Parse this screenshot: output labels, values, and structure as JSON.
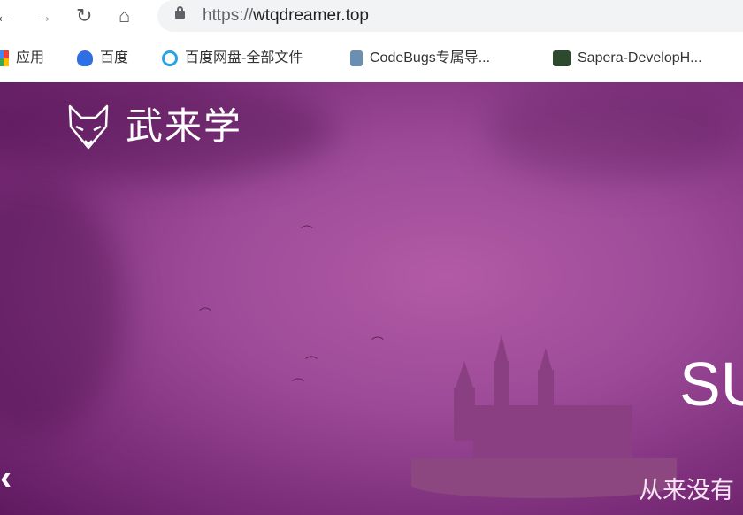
{
  "browser": {
    "url_scheme": "https://",
    "url_host": "wtqdreamer.top",
    "bookmarks": [
      {
        "label": "应用",
        "icon": "apps-grid-icon"
      },
      {
        "label": "百度",
        "icon": "baidu-paw-icon"
      },
      {
        "label": "百度网盘-全部文件",
        "icon": "baidu-netdisk-icon"
      },
      {
        "label": "CodeBugs专属导...",
        "icon": "cat-icon"
      },
      {
        "label": "Sapera-DevelopH...",
        "icon": "camera-device-icon"
      }
    ]
  },
  "site": {
    "logo_text": "武来学",
    "slide_title": "SU",
    "slide_subtitle": "从来没有"
  },
  "colors": {
    "hero": "#9c4a98",
    "omnibox": "#f1f3f4"
  }
}
